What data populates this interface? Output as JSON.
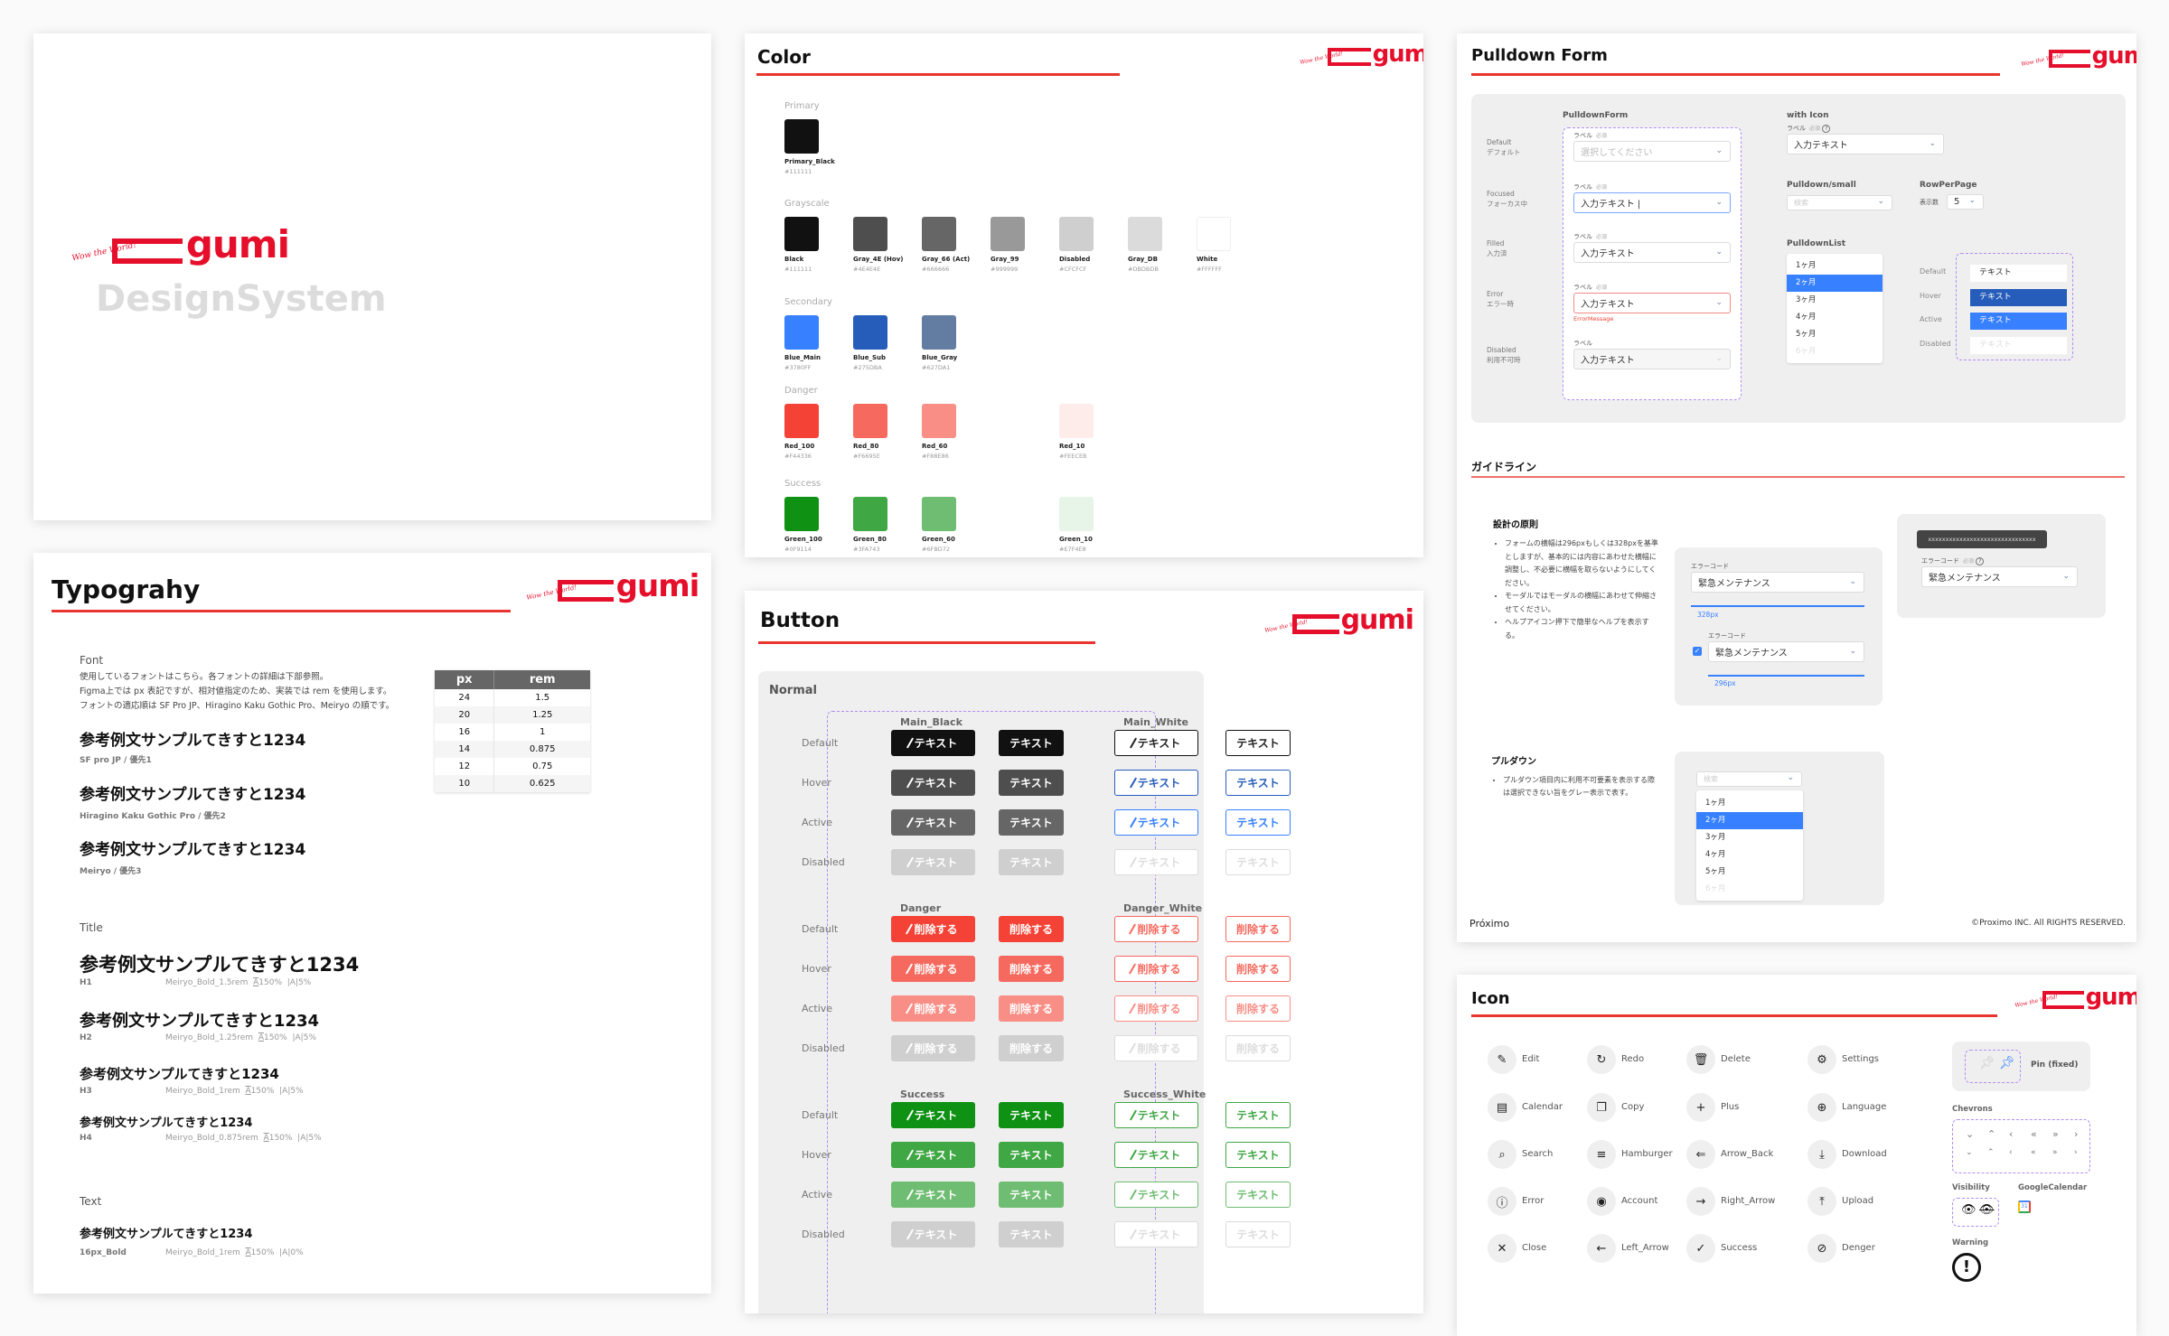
{
  "brand": {
    "word": "gumi",
    "tagline": "Wow the World!",
    "color": "#E50F2B"
  },
  "cover": {
    "subtitle": "DesignSystem"
  },
  "color_panel": {
    "title": "Color",
    "sections": [
      {
        "name": "Primary",
        "swatches": [
          {
            "name": "Primary_Black",
            "hex": "#111111"
          }
        ]
      },
      {
        "name": "Grayscale",
        "swatches": [
          {
            "name": "Black",
            "hex": "#111111"
          },
          {
            "name": "Gray_4E (Hov)",
            "hex": "#4E4E4E"
          },
          {
            "name": "Gray_66 (Act)",
            "hex": "#666666"
          },
          {
            "name": "Gray_99",
            "hex": "#999999"
          },
          {
            "name": "Disabled",
            "hex": "#CFCFCF"
          },
          {
            "name": "Gray_DB",
            "hex": "#DBDBDB"
          },
          {
            "name": "White",
            "hex": "#FFFFFF"
          }
        ]
      },
      {
        "name": "Secondary",
        "swatches": [
          {
            "name": "Blue_Main",
            "hex": "#3780FF"
          },
          {
            "name": "Blue_Sub",
            "hex": "#275DBA"
          },
          {
            "name": "Blue_Gray",
            "hex": "#627DA1"
          }
        ]
      },
      {
        "name": "Danger",
        "swatches": [
          {
            "name": "Red_100",
            "hex": "#F44336"
          },
          {
            "name": "Red_80",
            "hex": "#F6695E"
          },
          {
            "name": "Red_60",
            "hex": "#F88E86"
          },
          {
            "name": "Red_10",
            "hex": "#FEECEB"
          }
        ]
      },
      {
        "name": "Success",
        "swatches": [
          {
            "name": "Green_100",
            "hex": "#0F9114"
          },
          {
            "name": "Green_80",
            "hex": "#3FA743"
          },
          {
            "name": "Green_60",
            "hex": "#6FBD72"
          },
          {
            "name": "Green_10",
            "hex": "#E7F4E8"
          }
        ]
      }
    ]
  },
  "typography": {
    "title": "Typograhy",
    "font_heading": "Font",
    "font_desc": [
      "使用しているフォントはこちら。各フォントの詳細は下部参照。",
      "Figma上では px 表記ですが、相対値指定のため、実装では rem を使用します。",
      "フォントの適応順は SF Pro JP、Hiragino Kaku Gothic Pro、Meiryo の順です。"
    ],
    "sample": "参考例文サンプルてきすと1234",
    "fonts": [
      {
        "caption": "SF pro JP / 優先1"
      },
      {
        "caption": "Hiragino Kaku Gothic Pro / 優先2"
      },
      {
        "caption": "Meiryo / 優先3"
      }
    ],
    "table": {
      "headers": [
        "px",
        "rem"
      ],
      "rows": [
        [
          "24",
          "1.5"
        ],
        [
          "20",
          "1.25"
        ],
        [
          "16",
          "1"
        ],
        [
          "14",
          "0.875"
        ],
        [
          "12",
          "0.75"
        ],
        [
          "10",
          "0.625"
        ]
      ]
    },
    "title_heading": "Title",
    "titles": [
      {
        "tag": "H1",
        "spec": "Meiryo_Bold_1.5rem",
        "lh": "150%",
        "ls": "5%"
      },
      {
        "tag": "H2",
        "spec": "Meiryo_Bold_1.25rem",
        "lh": "150%",
        "ls": "5%"
      },
      {
        "tag": "H3",
        "spec": "Meiryo_Bold_1rem",
        "lh": "150%",
        "ls": "5%"
      },
      {
        "tag": "H4",
        "spec": "Meiryo_Bold_0.875rem",
        "lh": "150%",
        "ls": "5%"
      }
    ],
    "text_heading": "Text",
    "texts": [
      {
        "tag": "16px_Bold",
        "spec": "Meiryo_Bold_1rem",
        "lh": "150%",
        "ls": "0%"
      }
    ]
  },
  "button_panel": {
    "title": "Button",
    "section": "Normal",
    "states": [
      "Default",
      "Hover",
      "Active",
      "Disabled"
    ],
    "groups": [
      {
        "left": "Main_Black",
        "right": "Main_White",
        "label": "テキスト",
        "fill": [
          "#111111",
          "#4E4E4E",
          "#666666",
          "#CFCFCF"
        ],
        "outline": [
          "#111111",
          "#275DBA",
          "#3780FF",
          "#DBDBDB"
        ]
      },
      {
        "left": "Danger",
        "right": "Danger_White",
        "label": "削除する",
        "fill": [
          "#F44336",
          "#F6695E",
          "#F88E86",
          "#CFCFCF"
        ],
        "outline": [
          "#F6695E",
          "#F6695E",
          "#F88E86",
          "#DBDBDB"
        ]
      },
      {
        "left": "Success",
        "right": "Success_White",
        "label": "テキスト",
        "fill": [
          "#0F9114",
          "#3FA743",
          "#6FBD72",
          "#CFCFCF"
        ],
        "outline": [
          "#3FA743",
          "#3FA743",
          "#6FBD72",
          "#DBDBDB"
        ]
      }
    ]
  },
  "pulldown_panel": {
    "title": "Pulldown Form",
    "form_heading": "PulldownForm",
    "field_label": "ラベル",
    "required": "必須",
    "rows": [
      {
        "en": "Default",
        "ja": "デフォルト",
        "value": "選択してください",
        "state": "default"
      },
      {
        "en": "Focused",
        "ja": "フォーカス中",
        "value": "入力テキスト |",
        "state": "focused"
      },
      {
        "en": "Filled",
        "ja": "入力済",
        "value": "入力テキスト",
        "state": "filled"
      },
      {
        "en": "Error",
        "ja": "エラー時",
        "value": "入力テキスト",
        "state": "error",
        "error": "ErrorMessage"
      },
      {
        "en": "Disabled",
        "ja": "利用不可時",
        "value": "入力テキスト",
        "state": "disabled"
      }
    ],
    "with_icon": {
      "heading": "with Icon",
      "value": "入力テキスト"
    },
    "small": {
      "heading": "Pulldown/small",
      "placeholder": "検索"
    },
    "rpp": {
      "heading": "RowPerPage",
      "label": "表示数",
      "value": "5"
    },
    "list": {
      "heading": "PulldownList",
      "items": [
        "1ヶ月",
        "2ヶ月",
        "3ヶ月",
        "4ヶ月",
        "5ヶ月",
        "6ヶ月"
      ],
      "selected": 1,
      "disabled": 5
    },
    "item_states": {
      "states": [
        "Default",
        "Hover",
        "Active",
        "Disabled"
      ],
      "text": "テキスト"
    },
    "guide": {
      "title": "ガイドライン",
      "principle_title": "設計の原則",
      "principles": [
        "フォームの横幅は296pxもしくは328pxを基準としますが、基本的には内容にあわせた横幅に調整し、不必要に横幅を取らないようにしてください。",
        "モーダルではモーダルの横幅にあわせて伸縮させてください。",
        "ヘルプアイコン押下で簡単なヘルプを表示する。"
      ],
      "field_label": "エラーコード",
      "field_value": "緊急メンテナンス",
      "width1": "328px",
      "width2": "296px",
      "tooltip": "xxxxxxxxxxxxxxxxxxxxxxxxxxxxxxx",
      "pd_title": "プルダウン",
      "pd_desc": "プルダウン項目内に利用不可要素を表示する際は選択できない旨をグレー表示で表す。",
      "pd_placeholder": "検索"
    },
    "footer_left": "Próximo",
    "footer_right": "©Proximo INC. All RIGHTS RESERVED."
  },
  "icon_panel": {
    "title": "Icon",
    "icons": [
      {
        "name": "Edit",
        "glyph": "✎"
      },
      {
        "name": "Redo",
        "glyph": "↻"
      },
      {
        "name": "Delete",
        "glyph": "🗑"
      },
      {
        "name": "Settings",
        "glyph": "⚙"
      },
      {
        "name": "Calendar",
        "glyph": "▤"
      },
      {
        "name": "Copy",
        "glyph": "❐"
      },
      {
        "name": "Plus",
        "glyph": "+"
      },
      {
        "name": "Language",
        "glyph": "⊕"
      },
      {
        "name": "Search",
        "glyph": "⌕"
      },
      {
        "name": "Hamburger",
        "glyph": "≡"
      },
      {
        "name": "Arrow_Back",
        "glyph": "⇐"
      },
      {
        "name": "Download",
        "glyph": "⤓"
      },
      {
        "name": "Error",
        "glyph": "ⓘ"
      },
      {
        "name": "Account",
        "glyph": "◉"
      },
      {
        "name": "Right_Arrow",
        "glyph": "→"
      },
      {
        "name": "Upload",
        "glyph": "⤒"
      },
      {
        "name": "Close",
        "glyph": "✕"
      },
      {
        "name": "Left_Arrow",
        "glyph": "←"
      },
      {
        "name": "Success",
        "glyph": "✓"
      },
      {
        "name": "Denger",
        "glyph": "⊘"
      }
    ],
    "pin": "Pin (fixed)",
    "chevrons_heading": "Chevrons",
    "chevrons": [
      "⌄",
      "⌃",
      "‹",
      "«",
      "»",
      "›"
    ],
    "visibility_heading": "Visibility",
    "gcal_heading": "GoogleCalendar",
    "gcal_day": "31",
    "warning_heading": "Warning"
  }
}
